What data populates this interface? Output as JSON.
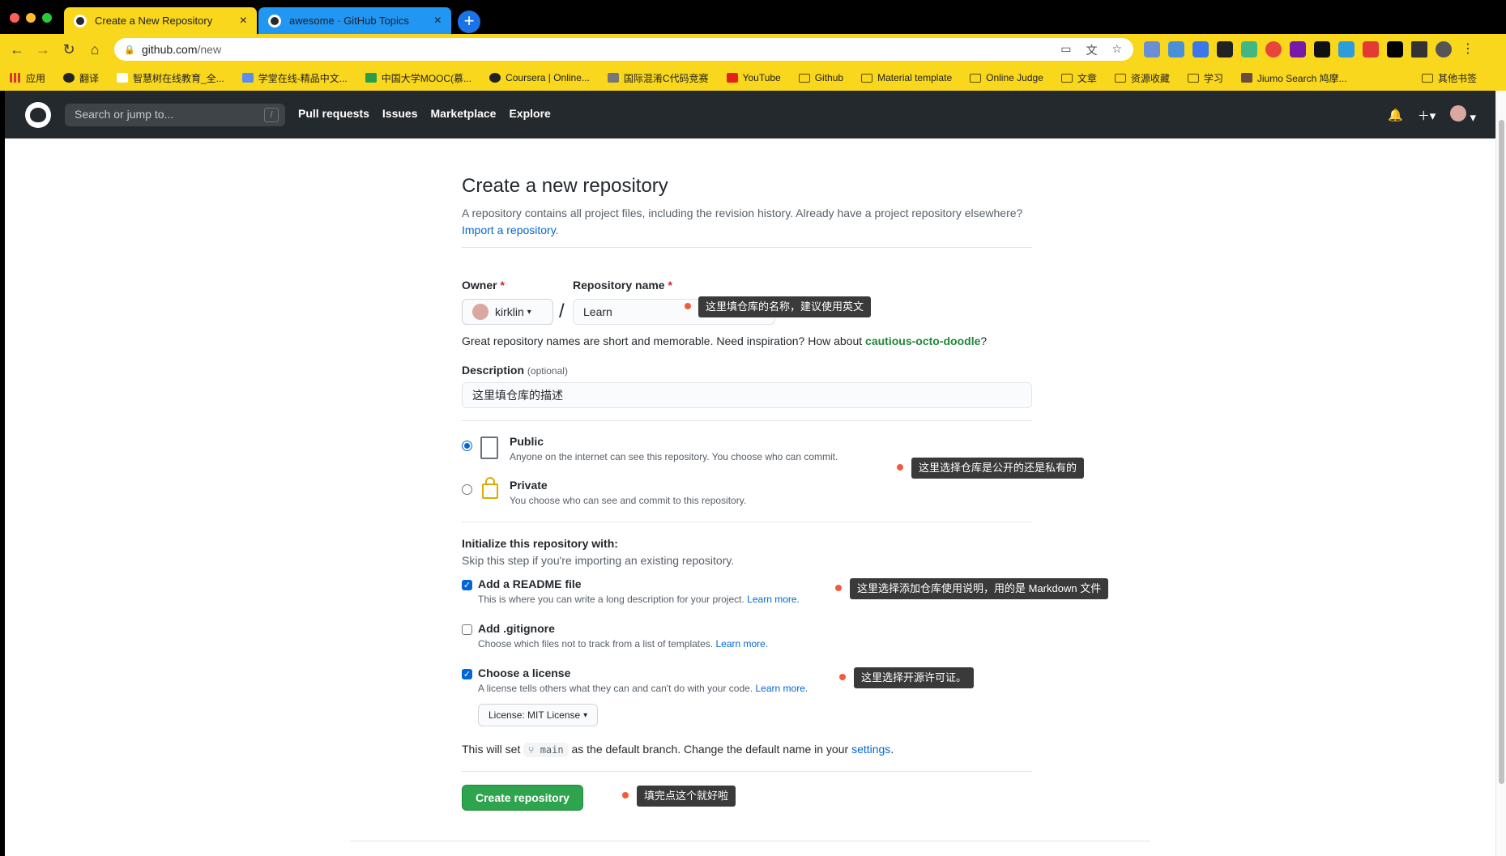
{
  "browser": {
    "tabs": [
      {
        "title": "Create a New Repository",
        "active": true
      },
      {
        "title": "awesome · GitHub Topics",
        "active": false
      }
    ],
    "url_host": "github.com",
    "url_path": "/new",
    "colors": {
      "chrome": "#000000",
      "toolbar": "#f9d71c",
      "active_tab": "#f9d71c",
      "inactive_tab": "#2196f3"
    },
    "bookmarks": [
      "应用",
      "翻译",
      "智慧树在线教育_全...",
      "学堂在线-精品中文...",
      "中国大学MOOC(慕...",
      "Coursera | Online...",
      "国际混淆C代码竞赛",
      "YouTube",
      "Github",
      "Material template",
      "Online Judge",
      "文章",
      "资源收藏",
      "学习",
      "Jiumo Search 鸠摩..."
    ],
    "bookmarks_other": "其他书签"
  },
  "github": {
    "search_placeholder": "Search or jump to...",
    "search_shortcut": "/",
    "nav": [
      "Pull requests",
      "Issues",
      "Marketplace",
      "Explore"
    ]
  },
  "form": {
    "title": "Create a new repository",
    "desc": "A repository contains all project files, including the revision history. Already have a project repository elsewhere?",
    "import_link": "Import a repository.",
    "owner_label": "Owner",
    "owner_value": "kirklin",
    "repo_label": "Repository name",
    "repo_value": "Learn",
    "required_mark": "*",
    "slash": "/",
    "name_hint": "Great repository names are short and memorable. Need inspiration? How about",
    "name_suggestion": "cautious-octo-doodle",
    "name_hint_end": "?",
    "desc_label": "Description",
    "desc_optional": "(optional)",
    "desc_value": "这里填仓库的描述",
    "visibility": {
      "public_title": "Public",
      "public_desc": "Anyone on the internet can see this repository. You choose who can commit.",
      "private_title": "Private",
      "private_desc": "You choose who can see and commit to this repository.",
      "selected": "public"
    },
    "init_title": "Initialize this repository with:",
    "init_desc": "Skip this step if you're importing an existing repository.",
    "readme_title": "Add a README file",
    "readme_desc": "This is where you can write a long description for your project.",
    "readme_checked": true,
    "gitignore_title": "Add .gitignore",
    "gitignore_desc": "Choose which files not to track from a list of templates.",
    "gitignore_checked": false,
    "license_title": "Choose a license",
    "license_desc": "A license tells others what they can and can't do with your code.",
    "license_checked": true,
    "learn_more": "Learn more.",
    "license_select": "License: MIT License",
    "branch_pre": "This will set",
    "branch_name": "main",
    "branch_post": "as the default branch. Change the default name in your",
    "settings_link": "settings",
    "period": ".",
    "create_button": "Create repository"
  },
  "annotations": {
    "repo_name": "这里填仓库的名称，建议使用英文",
    "visibility": "这里选择仓库是公开的还是私有的",
    "readme": "这里选择添加仓库使用说明，用的是 Markdown 文件",
    "license": "这里选择开源许可证。",
    "create": "填完点这个就好啦"
  }
}
